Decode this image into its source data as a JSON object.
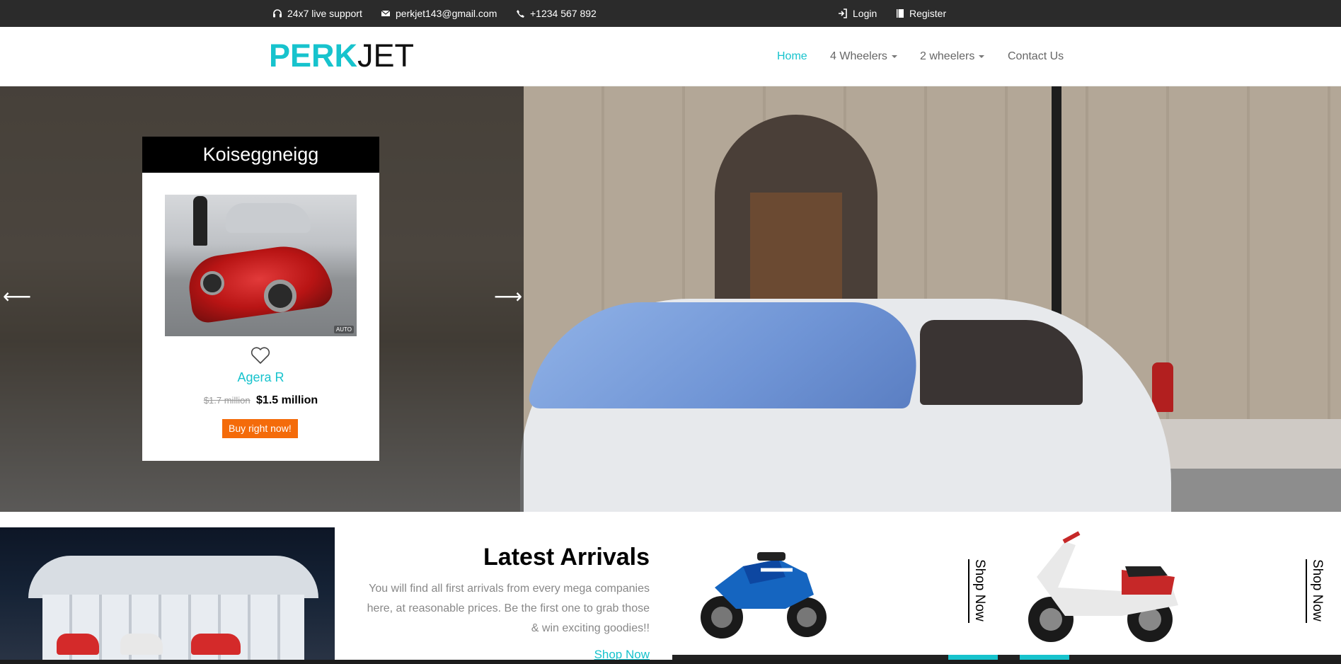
{
  "topbar": {
    "support": "24x7 live support",
    "email": "perkjet143@gmail.com",
    "phone": "+1234 567 892",
    "login": "Login",
    "register": "Register"
  },
  "header": {
    "logo_part1": "PERK",
    "logo_part2": "JET",
    "nav": {
      "home": "Home",
      "four_wheelers": "4 Wheelers",
      "two_wheelers": "2 wheelers",
      "contact": "Contact Us"
    }
  },
  "hero": {
    "prev_arrow": "⟵",
    "next_arrow": "⟶",
    "card": {
      "brand": "Koiseggneigg",
      "image_badge": "AUTO",
      "product_name": "Agera R",
      "old_price": "$1.7 million",
      "new_price": "$1.5 million",
      "buy_label": "Buy right now!"
    }
  },
  "arrivals": {
    "title": "Latest Arrivals",
    "description": "You will find all first arrivals from every mega companies here, at reasonable prices. Be the first one to grab those & win exciting goodies!!",
    "shop_link": "Shop Now"
  },
  "bikes": [
    {
      "shop_label": "Shop Now"
    },
    {
      "shop_label": "Shop Now"
    }
  ],
  "colors": {
    "accent": "#17c3cd",
    "buy_button": "#f46b0a",
    "topbar": "#2b2b2b"
  }
}
